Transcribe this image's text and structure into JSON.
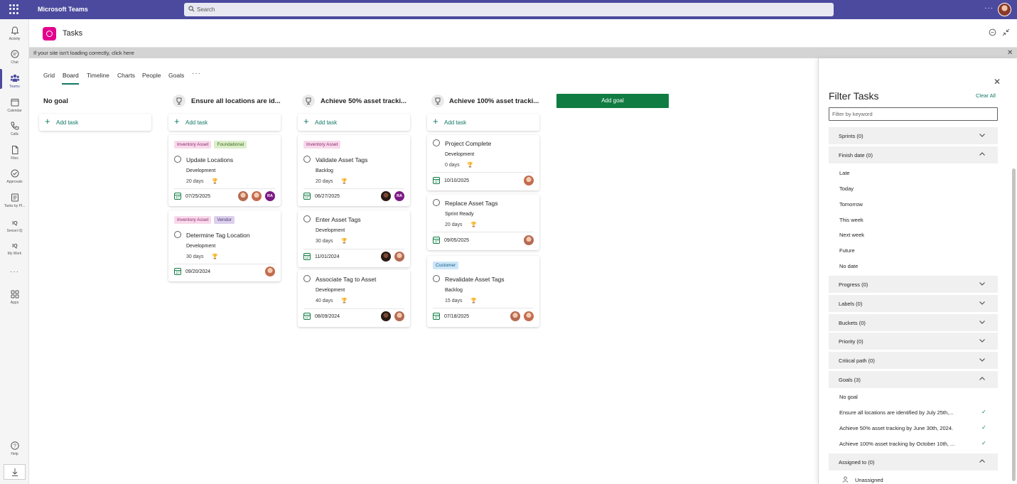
{
  "app": {
    "name": "Microsoft Teams",
    "search_placeholder": "Search",
    "more": "···"
  },
  "rail": [
    {
      "label": "Activity",
      "icon": "bell-icon"
    },
    {
      "label": "Chat",
      "icon": "chat-icon"
    },
    {
      "label": "Teams",
      "icon": "teams-icon"
    },
    {
      "label": "Calendar",
      "icon": "calendar-icon"
    },
    {
      "label": "Calls",
      "icon": "phone-icon"
    },
    {
      "label": "Files",
      "icon": "file-icon"
    },
    {
      "label": "Approvals",
      "icon": "approvals-icon"
    },
    {
      "label": "Tasks by Pl...",
      "icon": "tasks-icon"
    },
    {
      "label": "Sensei IQ",
      "icon": "iq-icon"
    },
    {
      "label": "My Work",
      "icon": "iq-icon"
    },
    {
      "label": "···",
      "icon": "more-icon"
    },
    {
      "label": "Apps",
      "icon": "apps-icon"
    },
    {
      "label": "Help",
      "icon": "help-icon"
    },
    {
      "label": "",
      "icon": "download-icon"
    }
  ],
  "header": {
    "title": "Tasks"
  },
  "warning": {
    "text": "If your site isn't loading correctly, click here",
    "close": "✕"
  },
  "tabs": [
    "Grid",
    "Board",
    "Timeline",
    "Charts",
    "People",
    "Goals"
  ],
  "tabs_more": "···",
  "board": {
    "add_task_label": "Add task",
    "add_goal_label": "Add goal",
    "columns": [
      {
        "title": "No goal",
        "cards": []
      },
      {
        "title": "Ensure all locations are id...",
        "cards": [
          {
            "labels": [
              "Inventory Asset",
              "Foundational"
            ],
            "title": "Update Locations",
            "bucket": "Development",
            "days": "20 days",
            "date": "07/25/2025"
          },
          {
            "labels": [
              "Inventory Asset",
              "Vendor"
            ],
            "title": "Determine Tag Location",
            "bucket": "Development",
            "days": "30 days",
            "date": "09/20/2024"
          }
        ]
      },
      {
        "title": "Achieve 50% asset tracki...",
        "cards": [
          {
            "labels": [
              "Inventory Asset"
            ],
            "title": "Validate Asset Tags",
            "bucket": "Backlog",
            "days": "20 days",
            "date": "06/27/2025"
          },
          {
            "labels": [],
            "title": "Enter Asset Tags",
            "bucket": "Development",
            "days": "30 days",
            "date": "11/01/2024"
          },
          {
            "labels": [],
            "title": "Associate Tag to Asset",
            "bucket": "Development",
            "days": "40 days",
            "date": "08/09/2024"
          }
        ]
      },
      {
        "title": "Achieve 100% asset tracki...",
        "cards": [
          {
            "labels": [],
            "title": "Project Complete",
            "bucket": "Development",
            "days": "0 days",
            "date": "10/10/2025"
          },
          {
            "labels": [],
            "title": "Replace Asset Tags",
            "bucket": "Sprint Ready",
            "days": "20 days",
            "date": "09/05/2025"
          },
          {
            "labels": [
              "Customer"
            ],
            "title": "Revalidate Asset Tags",
            "bucket": "Backlog",
            "days": "15 days",
            "date": "07/18/2025"
          }
        ]
      }
    ],
    "assignee_initials": "RA"
  },
  "filter": {
    "title": "Filter Tasks",
    "clear": "Clear All",
    "keyword_placeholder": "Filter by keyword",
    "sections": [
      {
        "label": "Sprints (0)"
      },
      {
        "label": "Finish date (0)",
        "options": [
          "Late",
          "Today",
          "Tomorrow",
          "This week",
          "Next week",
          "Future",
          "No date"
        ]
      },
      {
        "label": "Progress (0)"
      },
      {
        "label": "Labels (0)"
      },
      {
        "label": "Buckets (0)"
      },
      {
        "label": "Priority (0)"
      },
      {
        "label": "Critical path (0)"
      },
      {
        "label": "Goals (3)",
        "options": [
          "No goal",
          "Ensure all locations are identified by July 25th,...",
          "Achieve 50% asset tracking by June 30th, 2024.",
          "Achieve 100% asset tracking by October 10th, ..."
        ]
      },
      {
        "label": "Assigned to (0)",
        "options": [
          "Unassigned"
        ]
      }
    ],
    "check": "✓"
  },
  "colors": {
    "brand": "#4b4a9e",
    "accent": "#117865",
    "add_goal": "#107c41",
    "tasks_app": "#e3008c"
  }
}
